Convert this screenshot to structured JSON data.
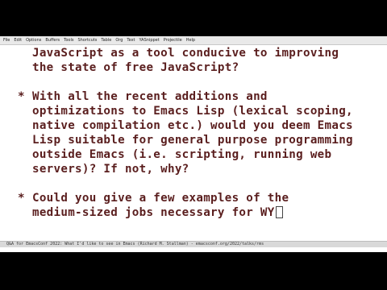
{
  "menubar": {
    "items": [
      "File",
      "Edit",
      "Options",
      "Buffers",
      "Tools",
      "Shortcuts",
      "Table",
      "Org",
      "Text",
      "YASnippet",
      "Projectile",
      "Help"
    ]
  },
  "buffer": {
    "lines": [
      "JavaScript as a tool conducive to improving",
      "the state of free JavaScript?",
      "With all the recent additions and",
      "optimizations to Emacs Lisp (lexical scoping,",
      "native compilation etc.) would you deem Emacs",
      "Lisp suitable for general purpose programming",
      "outside Emacs (i.e. scripting, running web",
      "servers)? If not, why?",
      "Could you give a few examples of the",
      "medium-sized jobs necessary for WY"
    ],
    "bullet": "*"
  },
  "modeline": {
    "text": "Q&A for EmacsConf 2022: What I'd like to see in Emacs (Richard M. Stallman) - emacsconf.org/2022/talks/rms"
  }
}
